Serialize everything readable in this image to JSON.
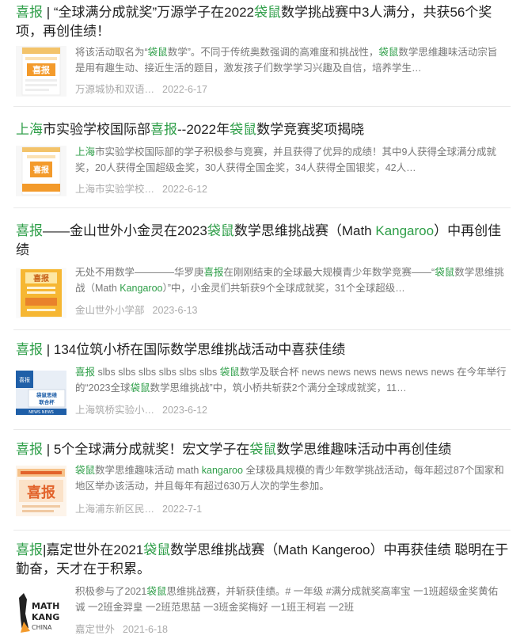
{
  "articles": [
    {
      "title_parts": [
        {
          "t": "喜报",
          "hl": true
        },
        {
          "t": " | “全球满分成就奖”万源学子在2022",
          "hl": false
        },
        {
          "t": "袋鼠",
          "hl": true
        },
        {
          "t": "数学挑战赛中3人满分，共获56个奖项，再创佳绩！",
          "hl": false
        }
      ],
      "snippet_parts": [
        {
          "t": "将该活动取名为“",
          "hl": false
        },
        {
          "t": "袋鼠",
          "hl": true
        },
        {
          "t": "数学”。不同于传统奥数强调的高难度和挑战性，",
          "hl": false
        },
        {
          "t": "袋鼠",
          "hl": true
        },
        {
          "t": "数学思维趣味活动宗旨是用有趣生动、接近生活的题目，激发孩子们数学学习兴趣及自信，培养学生…",
          "hl": false
        }
      ],
      "source": "万源城协和双语…",
      "date": "2022-6-17",
      "thumb": "poster-orange"
    },
    {
      "title_parts": [
        {
          "t": "上海",
          "hl": true
        },
        {
          "t": "市实验学校国际部",
          "hl": false
        },
        {
          "t": "喜报",
          "hl": true
        },
        {
          "t": "--2022年",
          "hl": false
        },
        {
          "t": "袋鼠",
          "hl": true
        },
        {
          "t": "数学竞赛奖项揭晓",
          "hl": false
        }
      ],
      "snippet_parts": [
        {
          "t": "上海",
          "hl": true
        },
        {
          "t": "市实验学校国际部的学子积极参与竞赛，并且获得了优异的成绩！其中9人获得全球满分成就奖，20人获得全国超级金奖，30人获得全国金奖，34人获得全国银奖，42人…",
          "hl": false
        }
      ],
      "source": "上海市实验学校…",
      "date": "2022-6-12",
      "thumb": "poster-orange-b"
    },
    {
      "title_parts": [
        {
          "t": "喜报",
          "hl": true
        },
        {
          "t": "——金山世外小金灵在2023",
          "hl": false
        },
        {
          "t": "袋鼠",
          "hl": true
        },
        {
          "t": "数学思维挑战赛（Math ",
          "hl": false
        },
        {
          "t": "Kangaroo",
          "hl": true
        },
        {
          "t": "）中再创佳绩",
          "hl": false
        }
      ],
      "snippet_parts": [
        {
          "t": "无处不用数学————华罗庚",
          "hl": false
        },
        {
          "t": "喜报",
          "hl": true
        },
        {
          "t": "在刚刚结束的全球最大规模青少年数学竞赛——“",
          "hl": false
        },
        {
          "t": "袋鼠",
          "hl": true
        },
        {
          "t": "数学思维挑战（Math ",
          "hl": false
        },
        {
          "t": "Kangaroo",
          "hl": true
        },
        {
          "t": "）”中，小金灵们共斩获9个全球成就奖，31个全球超级…",
          "hl": false
        }
      ],
      "source": "金山世外小学部",
      "date": "2023-6-13",
      "thumb": "poster-yellow"
    },
    {
      "title_parts": [
        {
          "t": "喜报",
          "hl": true
        },
        {
          "t": " | 134位筑小桥在国际数学思维挑战活动中喜获佳绩",
          "hl": false
        }
      ],
      "snippet_parts": [
        {
          "t": "喜报",
          "hl": true
        },
        {
          "t": " slbs slbs slbs slbs slbs slbs ",
          "hl": false
        },
        {
          "t": "袋鼠",
          "hl": true
        },
        {
          "t": "数学及联合杯 news news news news news news 在今年举行的“2023全球",
          "hl": false
        },
        {
          "t": "袋鼠",
          "hl": true
        },
        {
          "t": "数学思维挑战”中，筑小桥共斩获2个满分全球成就奖，11…",
          "hl": false
        }
      ],
      "source": "上海筑桥实验小…",
      "date": "2023-6-12",
      "thumb": "poster-blue"
    },
    {
      "title_parts": [
        {
          "t": "喜报",
          "hl": true
        },
        {
          "t": " | 5个全球满分成就奖！宏文学子在",
          "hl": false
        },
        {
          "t": "袋鼠",
          "hl": true
        },
        {
          "t": "数学思维趣味活动中再创佳绩",
          "hl": false
        }
      ],
      "snippet_parts": [
        {
          "t": "袋鼠",
          "hl": true
        },
        {
          "t": "数学思维趣味活动 math ",
          "hl": false
        },
        {
          "t": "kangaroo",
          "hl": true
        },
        {
          "t": " 全球极具规模的青少年数学挑战活动，每年超过87个国家和地区举办该活动，并且每年有超过630万人次的学生参加。",
          "hl": false
        }
      ],
      "source": "上海浦东新区民…",
      "date": "2022-7-1",
      "thumb": "poster-red"
    },
    {
      "title_parts": [
        {
          "t": "喜报",
          "hl": true
        },
        {
          "t": "|嘉定世外在2021",
          "hl": false
        },
        {
          "t": "袋鼠",
          "hl": true
        },
        {
          "t": "数学思维挑战赛（Math Kangeroo）中再获佳绩 聪明在于勤奋，天才在于积累。",
          "hl": false
        }
      ],
      "snippet_parts": [
        {
          "t": "积极参与了2021",
          "hl": false
        },
        {
          "t": "袋鼠",
          "hl": true
        },
        {
          "t": "思维挑战赛，并斩获佳绩。# 一年级 #满分成就奖高率宝 一1班超级金奖黄佑诚 一2班金羿皇 一2班范思喆 一3班金奖梅好 一1班王柯岩 一2班",
          "hl": false
        }
      ],
      "source": "嘉定世外",
      "date": "2021-6-18",
      "thumb": "logo-mathkangaroo",
      "logo_line1": "MATH",
      "logo_line2": "KANG",
      "logo_line3": "CHINA"
    }
  ],
  "thumb_texts": {
    "poster_title": "喜报",
    "poster_small": "袋鼠思维",
    "poster_small2": "联合杯",
    "poster_news": "NEWS NEWS"
  },
  "colors": {
    "highlight": "#2e9e48",
    "title_text": "#222222",
    "snippet_text": "#777777",
    "meta_text": "#aaaaaa",
    "poster_orange": "#f39a2b",
    "poster_yellow": "#f6b733",
    "poster_blue": "#1f5fa8",
    "poster_red": "#e2632b"
  }
}
